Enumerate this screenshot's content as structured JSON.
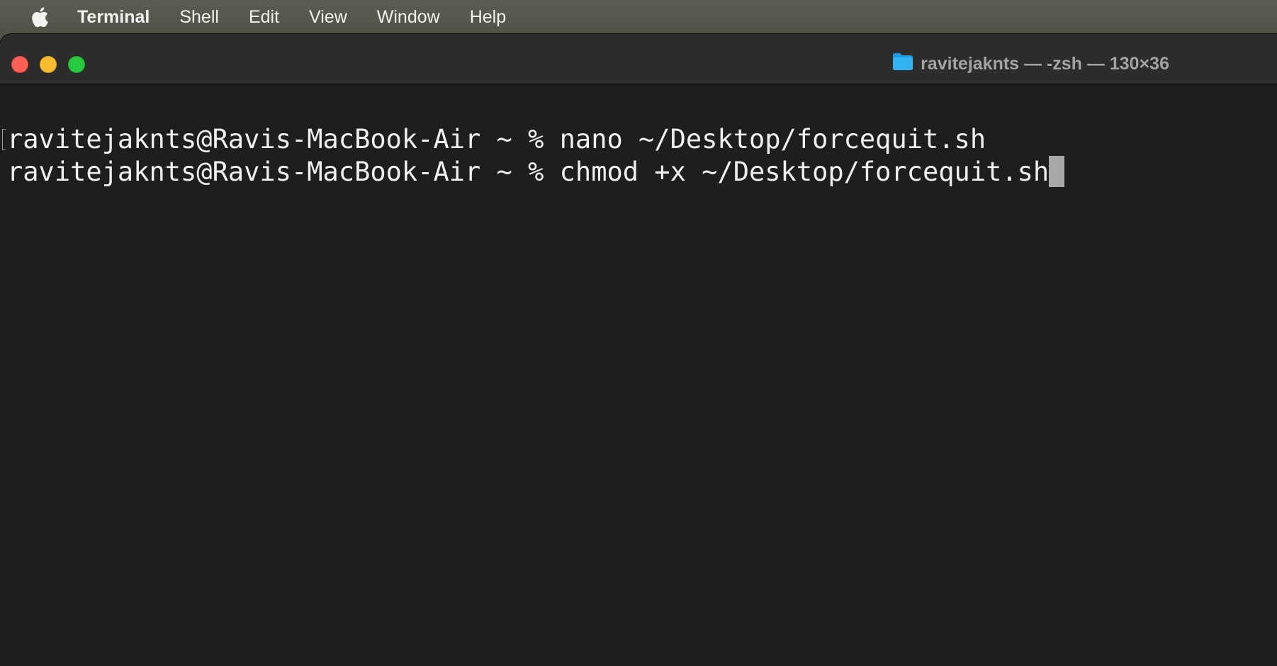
{
  "menubar": {
    "apple_icon": "apple-logo-icon",
    "app_name": "Terminal",
    "items": [
      "Shell",
      "Edit",
      "View",
      "Window",
      "Help"
    ]
  },
  "window": {
    "folder_icon": "folder-icon",
    "title": "ravitejaknts — -zsh — 130×36",
    "traffic_lights": {
      "close": "#ff5f57",
      "minimize": "#febc2e",
      "zoom": "#28c840"
    }
  },
  "terminal": {
    "background": "#1e1e1e",
    "text_color": "#f0f0f0",
    "lines": [
      "ravitejaknts@Ravis-MacBook-Air ~ % nano ~/Desktop/forcequit.sh",
      "ravitejaknts@Ravis-MacBook-Air ~ % chmod +x ~/Desktop/forcequit.sh"
    ]
  }
}
